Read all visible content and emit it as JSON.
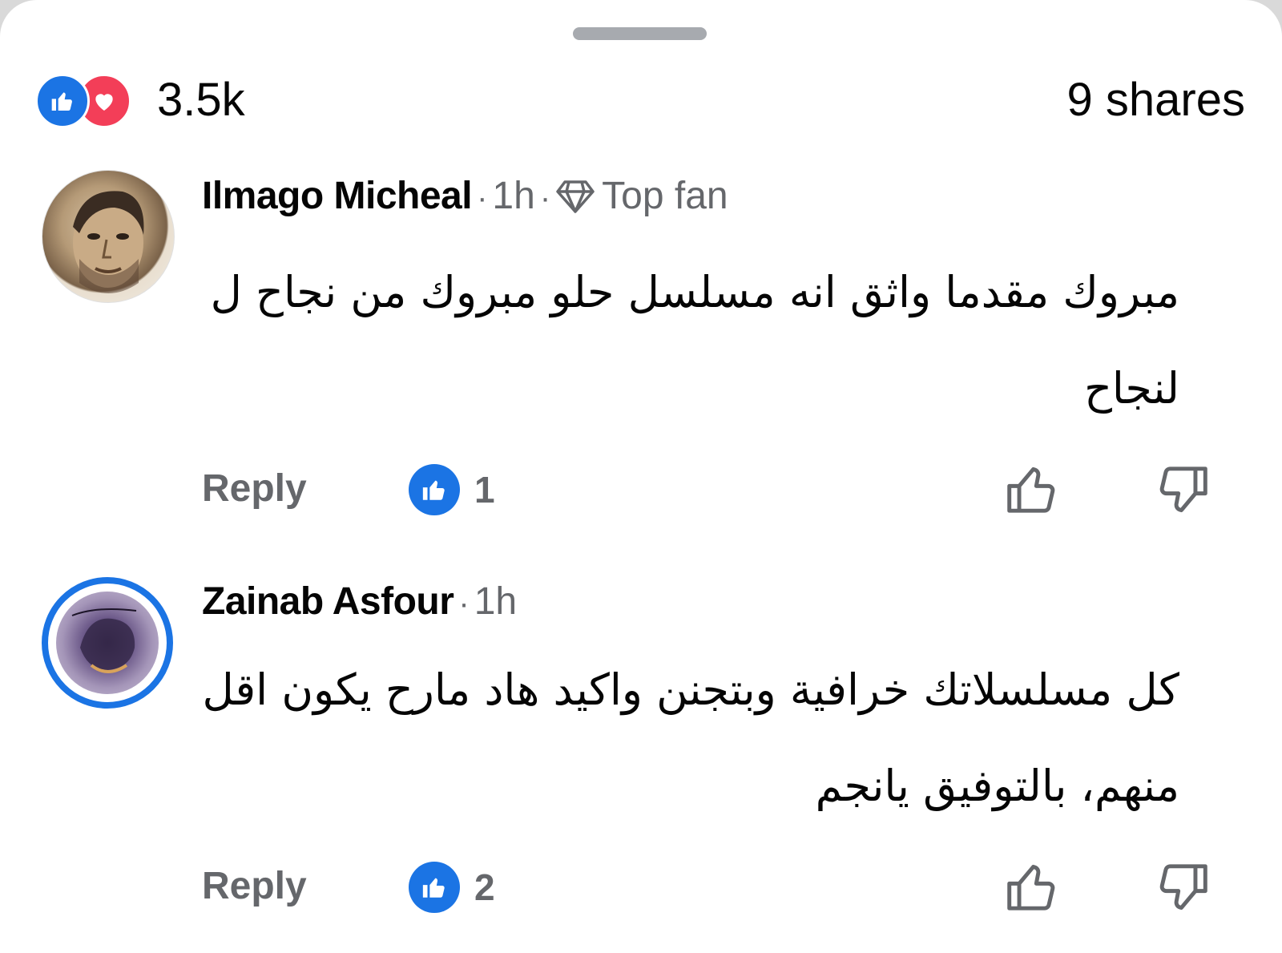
{
  "summary": {
    "reaction_count": "3.5k",
    "shares": "9 shares",
    "reactions": [
      "like-icon",
      "love-icon"
    ]
  },
  "comments": [
    {
      "author": "Ilmago Micheal",
      "time": "1h",
      "badge": "Top fan",
      "text": "مبروك مقدما واثق انه مسلسل حلو مبروك من نجاح ل لنجاح",
      "reply_label": "Reply",
      "like_count": "1"
    },
    {
      "author": "Zainab Asfour",
      "time": "1h",
      "text": "كل مسلسلاتك خرافية وبتجنن واكيد هاد مارح يكون اقل منهم، بالتوفيق يانجم",
      "reply_label": "Reply",
      "like_count": "2"
    }
  ],
  "colors": {
    "like_blue": "#1b74e4",
    "love_red": "#f33e58",
    "secondary_text": "#65676b",
    "primary_text": "#050505"
  }
}
